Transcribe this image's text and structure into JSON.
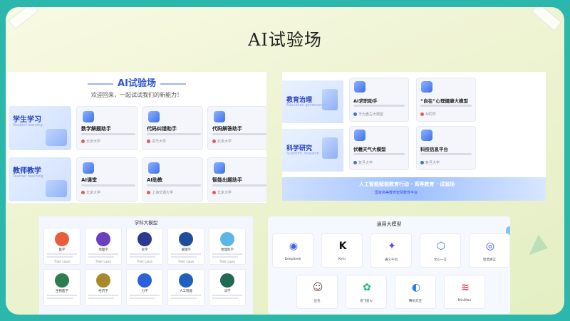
{
  "slide": {
    "title": "AI试验场"
  },
  "panel1": {
    "title": "AI试验场",
    "subtitle": "欢迎回来，一起试试我们的新能力！",
    "categories": [
      {
        "name": "学生学习",
        "en": "Student learning"
      },
      {
        "name": "教师教学",
        "en": "Teacher teaching"
      }
    ],
    "rows": [
      [
        {
          "name": "数学解题助手",
          "org": "北京大学"
        },
        {
          "name": "代码纠错助手",
          "org": "清华大学"
        },
        {
          "name": "代码解答助手",
          "org": "北京大学"
        }
      ],
      [
        {
          "name": "AI课堂",
          "org": "北京大学"
        },
        {
          "name": "AI助教",
          "org": "上海交通大学"
        },
        {
          "name": "智能出题助手",
          "org": "北京大学"
        }
      ]
    ]
  },
  "panel2": {
    "categories": [
      {
        "name": "教育治理",
        "en": "Education governance"
      },
      {
        "name": "科学研究",
        "en": "Scientific research"
      }
    ],
    "rows": [
      [
        {
          "name": "AI求职助手",
          "org": "华为盘古大模型"
        },
        {
          "name": "“自在”心理健康大模型",
          "org": "AI同学"
        }
      ],
      [
        {
          "name": "伏羲天气大模型",
          "org": "复旦大学"
        },
        {
          "name": "科技信息平台",
          "org": "复旦大学"
        }
      ]
    ],
    "banner_line1": "人工智能赋能教育行动 · 高等教育 · 试验场",
    "banner_line2": "国家高等教育智慧教育平台"
  },
  "panel3": {
    "title": "学科大模型",
    "row1": [
      {
        "name": "医学",
        "footer": "Their Laian",
        "color": "#e85d3c"
      },
      {
        "name": "地理学",
        "footer": "Their Laian",
        "color": "#6a3fc0"
      },
      {
        "name": "化学",
        "footer": "Their Laian",
        "color": "#2b3a8f"
      },
      {
        "name": "逻辑学",
        "footer": "Their Laian",
        "color": "#1e4e9a"
      },
      {
        "name": "地理科学",
        "footer": "Their Laian",
        "color": "#5bb6e6"
      }
    ],
    "row2": [
      {
        "name": "生物医学",
        "footer": "",
        "color": "#2e7d4f"
      },
      {
        "name": "经济学",
        "footer": "",
        "color": "#a9892a"
      },
      {
        "name": "力学",
        "footer": "",
        "color": "#2b62d9"
      },
      {
        "name": "人工智能",
        "footer": "",
        "color": "#1f5fbf"
      },
      {
        "name": "法学",
        "footer": "",
        "color": "#1f6a52"
      }
    ]
  },
  "panel4": {
    "title": "通用大模型",
    "row1": [
      {
        "name": "DeepSeek",
        "glyph": "◉",
        "color": "#3e63e0"
      },
      {
        "name": "Kimi",
        "glyph": "K",
        "color": "#111111"
      },
      {
        "name": "通义千问",
        "glyph": "✦",
        "color": "#5b4be0"
      },
      {
        "name": "文心一言",
        "glyph": "⬡",
        "color": "#2b6fe8"
      },
      {
        "name": "智谱清言",
        "glyph": "◎",
        "color": "#2f4be0"
      }
    ],
    "row2": [
      {
        "name": "豆包",
        "glyph": "☺",
        "color": "#6b4b3e"
      },
      {
        "name": "讯飞星火",
        "glyph": "✿",
        "color": "#24b37a"
      },
      {
        "name": "腾讯元宝",
        "glyph": "◐",
        "color": "#2b7ce8"
      },
      {
        "name": "MiniMax",
        "glyph": "≋",
        "color": "#e0445b"
      }
    ]
  }
}
